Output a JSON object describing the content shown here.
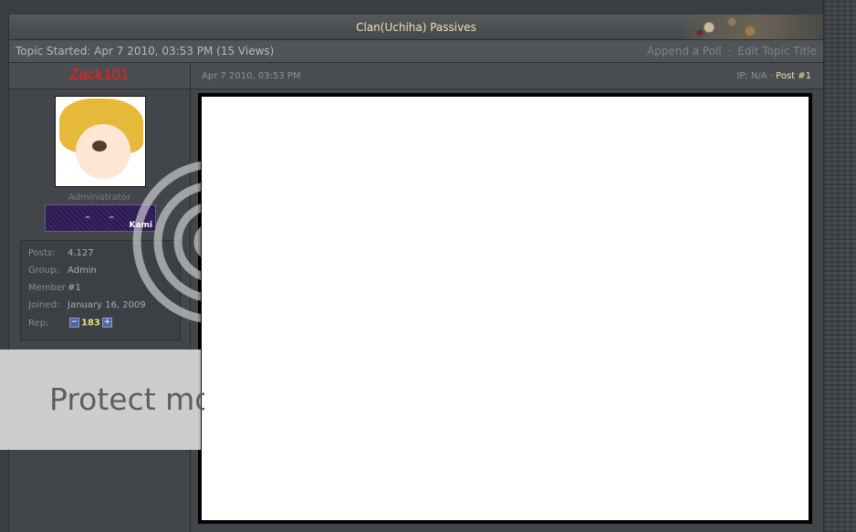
{
  "topic": {
    "title": "Clan(Uchiha) Passives",
    "started": "Topic Started: Apr 7 2010, 03:53 PM (15 Views)",
    "actions": {
      "append_poll": "Append a Poll",
      "separator": "·",
      "edit_title": "Edit Topic Title"
    }
  },
  "poster": {
    "username": "Zack101",
    "username_color": "#ff1a1a",
    "role": "Administrator",
    "rank_image_label": "Kami",
    "stats": {
      "posts_label": "Posts:",
      "posts": "4,127",
      "group_label": "Group:",
      "group": "Admin",
      "member_label": "Member",
      "member": "#1",
      "joined_label": "Joined:",
      "joined": "January 16, 2009",
      "rep_label": "Rep:",
      "rep": "183",
      "rep_minus": "−",
      "rep_plus": "+"
    }
  },
  "post": {
    "date": "Apr 7 2010, 03:53 PM",
    "ip": "IP: N/A ·",
    "number": "Post #1"
  },
  "watermark": {
    "text": "Protect more of your memories for less!"
  },
  "colors": {
    "title_text": "#ece2b4",
    "background": "#3a3e42",
    "rep_value": "#ecd98a"
  }
}
